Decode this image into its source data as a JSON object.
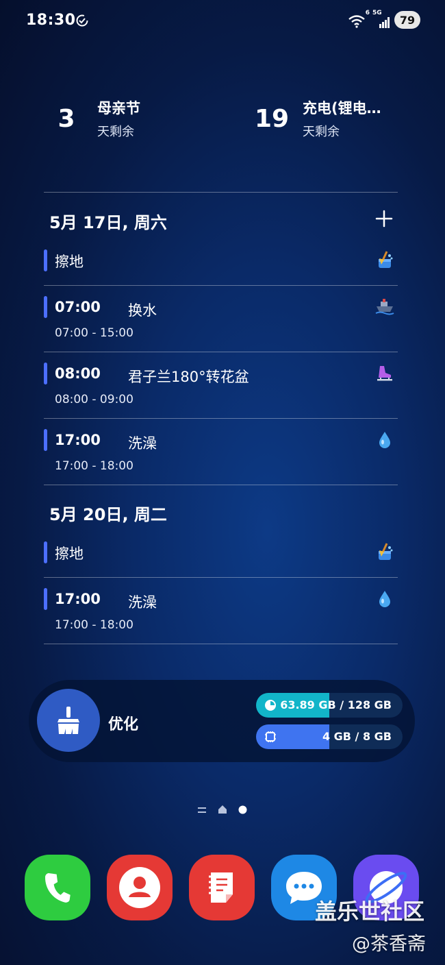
{
  "status_bar": {
    "time": "18:30",
    "wifi_label": "6",
    "network_label": "5G",
    "battery": "79"
  },
  "countdowns": [
    {
      "days": "3",
      "title": "母亲节",
      "subtitle": "天剩余"
    },
    {
      "days": "19",
      "title": "充电(锂电…",
      "subtitle": "天剩余"
    }
  ],
  "calendar": {
    "days": [
      {
        "date": "5月 17日, 周六",
        "events": [
          {
            "time": "",
            "title": "擦地",
            "range": "",
            "icon": "broom-bucket-icon"
          },
          {
            "time": "07:00",
            "title": "换水",
            "range": "07:00 - 15:00",
            "icon": "ship-icon"
          },
          {
            "time": "08:00",
            "title": "君子兰180°转花盆",
            "range": "08:00 - 09:00",
            "icon": "ice-skate-icon"
          },
          {
            "time": "17:00",
            "title": "洗澡",
            "range": "17:00 - 18:00",
            "icon": "water-drop-icon"
          }
        ]
      },
      {
        "date": "5月 20日, 周二",
        "events": [
          {
            "time": "",
            "title": "擦地",
            "range": "",
            "icon": "broom-bucket-icon"
          },
          {
            "time": "17:00",
            "title": "洗澡",
            "range": "17:00 - 18:00",
            "icon": "water-drop-icon"
          }
        ]
      }
    ]
  },
  "optimize_widget": {
    "label": "优化",
    "storage_text": "63.89 GB / 128 GB",
    "storage_fraction": 0.4991,
    "ram_text": "4 GB / 8 GB",
    "ram_fraction": 0.5,
    "storage_color": "#12b5c9",
    "ram_color": "#3f74f0"
  },
  "dock": {
    "apps": [
      "phone-app",
      "contacts-app",
      "notes-app",
      "messages-app",
      "browser-app"
    ]
  },
  "watermark": {
    "site": "盖乐世社区",
    "user": "@茶香斋"
  },
  "colors": {
    "event_bar": "#4c6fff",
    "phone": "#2ecc40",
    "contacts": "#e53935",
    "notes": "#e53935",
    "messages": "#1e88e5",
    "browser": "#6a4cf0"
  }
}
